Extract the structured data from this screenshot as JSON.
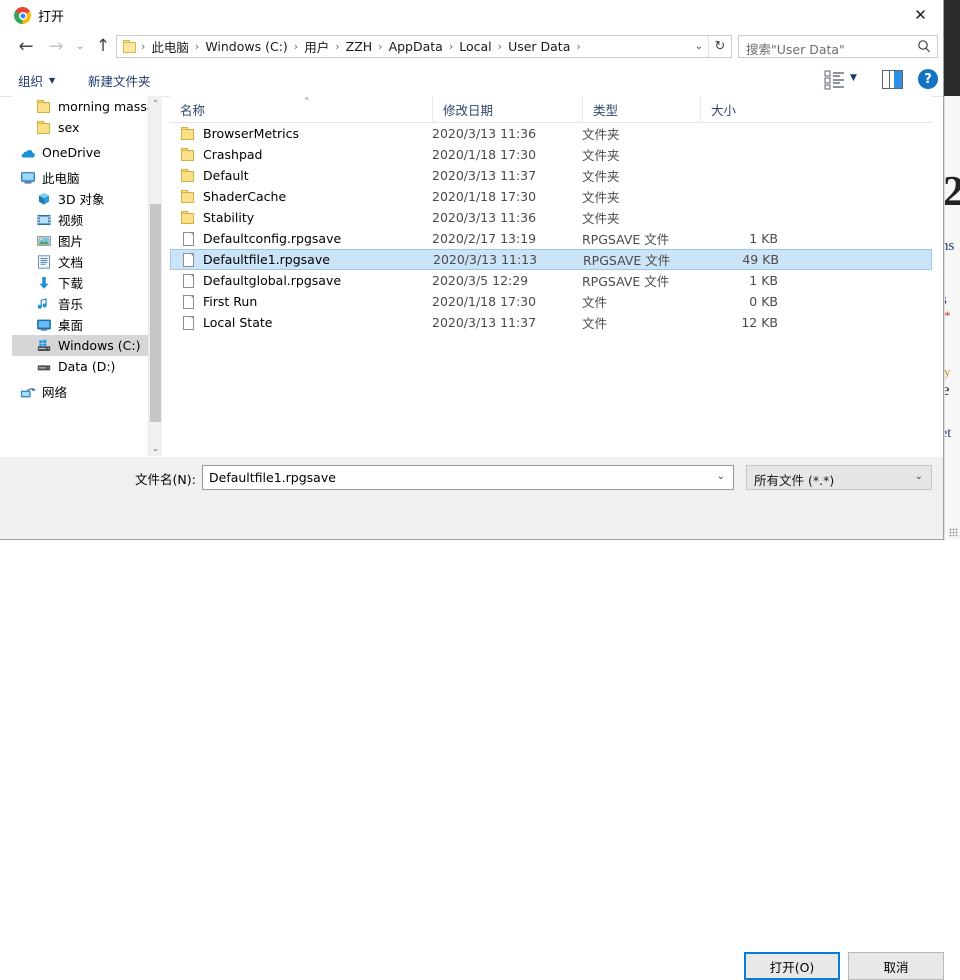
{
  "window": {
    "title": "打开",
    "app_icon": "chrome-icon",
    "close_label": "✕"
  },
  "address_bar": {
    "nav": {
      "back": "←",
      "forward": "→",
      "recent": "⌄",
      "up": "↑"
    },
    "breadcrumb": [
      "此电脑",
      "Windows (C:)",
      "用户",
      "ZZH",
      "AppData",
      "Local",
      "User Data"
    ],
    "separator": "›",
    "dropdown": "⌄",
    "refresh": "↻"
  },
  "search": {
    "placeholder": "搜索\"User Data\"",
    "icon": "search-icon"
  },
  "toolbar": {
    "organize_label": "组织",
    "organize_caret": "▼",
    "new_folder_label": "新建文件夹",
    "view_mode_caret": "▼",
    "help_label": "?"
  },
  "sidebar": {
    "items": [
      {
        "label": "morning massa",
        "icon": "folder-icon",
        "indent": 24,
        "selected": false
      },
      {
        "label": "sex",
        "icon": "folder-icon",
        "indent": 24,
        "selected": false
      },
      {
        "label": "OneDrive",
        "icon": "onedrive-icon",
        "indent": 8,
        "selected": false
      },
      {
        "label": "此电脑",
        "icon": "this-pc-icon",
        "indent": 8,
        "selected": false
      },
      {
        "label": "3D 对象",
        "icon": "3d-objects-icon",
        "indent": 24,
        "selected": false
      },
      {
        "label": "视频",
        "icon": "videos-icon",
        "indent": 24,
        "selected": false
      },
      {
        "label": "图片",
        "icon": "pictures-icon",
        "indent": 24,
        "selected": false
      },
      {
        "label": "文档",
        "icon": "documents-icon",
        "indent": 24,
        "selected": false
      },
      {
        "label": "下载",
        "icon": "downloads-icon",
        "indent": 24,
        "selected": false
      },
      {
        "label": "音乐",
        "icon": "music-icon",
        "indent": 24,
        "selected": false
      },
      {
        "label": "桌面",
        "icon": "desktop-icon",
        "indent": 24,
        "selected": false
      },
      {
        "label": "Windows (C:)",
        "icon": "drive-windows-icon",
        "indent": 24,
        "selected": true
      },
      {
        "label": "Data (D:)",
        "icon": "drive-icon",
        "indent": 24,
        "selected": false
      },
      {
        "label": "网络",
        "icon": "network-icon",
        "indent": 8,
        "selected": false
      }
    ],
    "scrollbar": {
      "up_arrow": "⌃",
      "down_arrow": "⌄"
    }
  },
  "file_list": {
    "columns": [
      "名称",
      "修改日期",
      "类型",
      "大小"
    ],
    "sort_arrow": "⌃",
    "rows": [
      {
        "name": "BrowserMetrics",
        "date": "2020/3/13 11:36",
        "type": "文件夹",
        "size": "",
        "icon": "folder-icon",
        "selected": false
      },
      {
        "name": "Crashpad",
        "date": "2020/1/18 17:30",
        "type": "文件夹",
        "size": "",
        "icon": "folder-icon",
        "selected": false
      },
      {
        "name": "Default",
        "date": "2020/3/13 11:37",
        "type": "文件夹",
        "size": "",
        "icon": "folder-icon",
        "selected": false
      },
      {
        "name": "ShaderCache",
        "date": "2020/1/18 17:30",
        "type": "文件夹",
        "size": "",
        "icon": "folder-icon",
        "selected": false
      },
      {
        "name": "Stability",
        "date": "2020/3/13 11:36",
        "type": "文件夹",
        "size": "",
        "icon": "folder-icon",
        "selected": false
      },
      {
        "name": "Defaultconfig.rpgsave",
        "date": "2020/2/17 13:19",
        "type": "RPGSAVE 文件",
        "size": "1 KB",
        "icon": "file-icon",
        "selected": false
      },
      {
        "name": "Defaultfile1.rpgsave",
        "date": "2020/3/13 11:13",
        "type": "RPGSAVE 文件",
        "size": "49 KB",
        "icon": "file-icon",
        "selected": true
      },
      {
        "name": "Defaultglobal.rpgsave",
        "date": "2020/3/5 12:29",
        "type": "RPGSAVE 文件",
        "size": "1 KB",
        "icon": "file-icon",
        "selected": false
      },
      {
        "name": "First Run",
        "date": "2020/1/18 17:30",
        "type": "文件",
        "size": "0 KB",
        "icon": "file-icon",
        "selected": false
      },
      {
        "name": "Local State",
        "date": "2020/3/13 11:37",
        "type": "文件",
        "size": "12 KB",
        "icon": "file-icon",
        "selected": false
      }
    ]
  },
  "footer": {
    "filename_label": "文件名(N):",
    "filename_value": "Defaultfile1.rpgsave",
    "filename_caret": "⌄",
    "filter_value": "所有文件 (*.*)",
    "filter_caret": "⌄",
    "open_button": "打开(O)",
    "cancel_button": "取消"
  },
  "background": {
    "fragments": [
      "2",
      "ns",
      "s",
      "*",
      "y",
      "e",
      "et"
    ]
  },
  "colors": {
    "accent": "#0a7bd0",
    "selection": "#cce4f7",
    "selection_border": "#9fc8e8",
    "sidebar_selection": "#d6d6d6",
    "header_text": "#30466b",
    "toolbar_text": "#1b3a6b",
    "chrome_blue": "#4285f4"
  }
}
